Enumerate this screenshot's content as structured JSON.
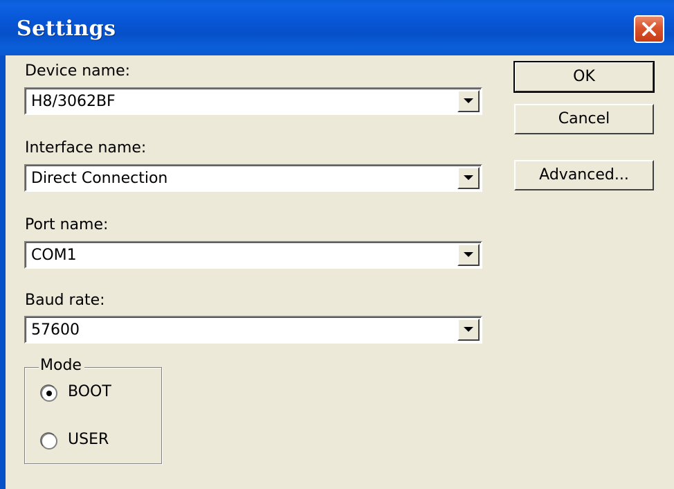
{
  "window": {
    "title": "Settings"
  },
  "fields": {
    "device": {
      "label": "Device name:",
      "value": "H8/3062BF"
    },
    "interface": {
      "label": "Interface name:",
      "value": "Direct Connection"
    },
    "port": {
      "label": "Port name:",
      "value": "COM1"
    },
    "baud": {
      "label": "Baud rate:",
      "value": "57600"
    }
  },
  "buttons": {
    "ok": "OK",
    "cancel": "Cancel",
    "advanced": "Advanced..."
  },
  "mode": {
    "title": "Mode",
    "options": [
      {
        "label": "BOOT",
        "selected": true
      },
      {
        "label": "USER",
        "selected": false
      }
    ]
  },
  "icons": {
    "close": "close-icon",
    "dropdown": "chevron-down-icon",
    "radio": "radio-icon"
  },
  "colors": {
    "titlebar": "#0650c9",
    "dialog_bg": "#ece9d8",
    "close_button": "#d9542c"
  }
}
